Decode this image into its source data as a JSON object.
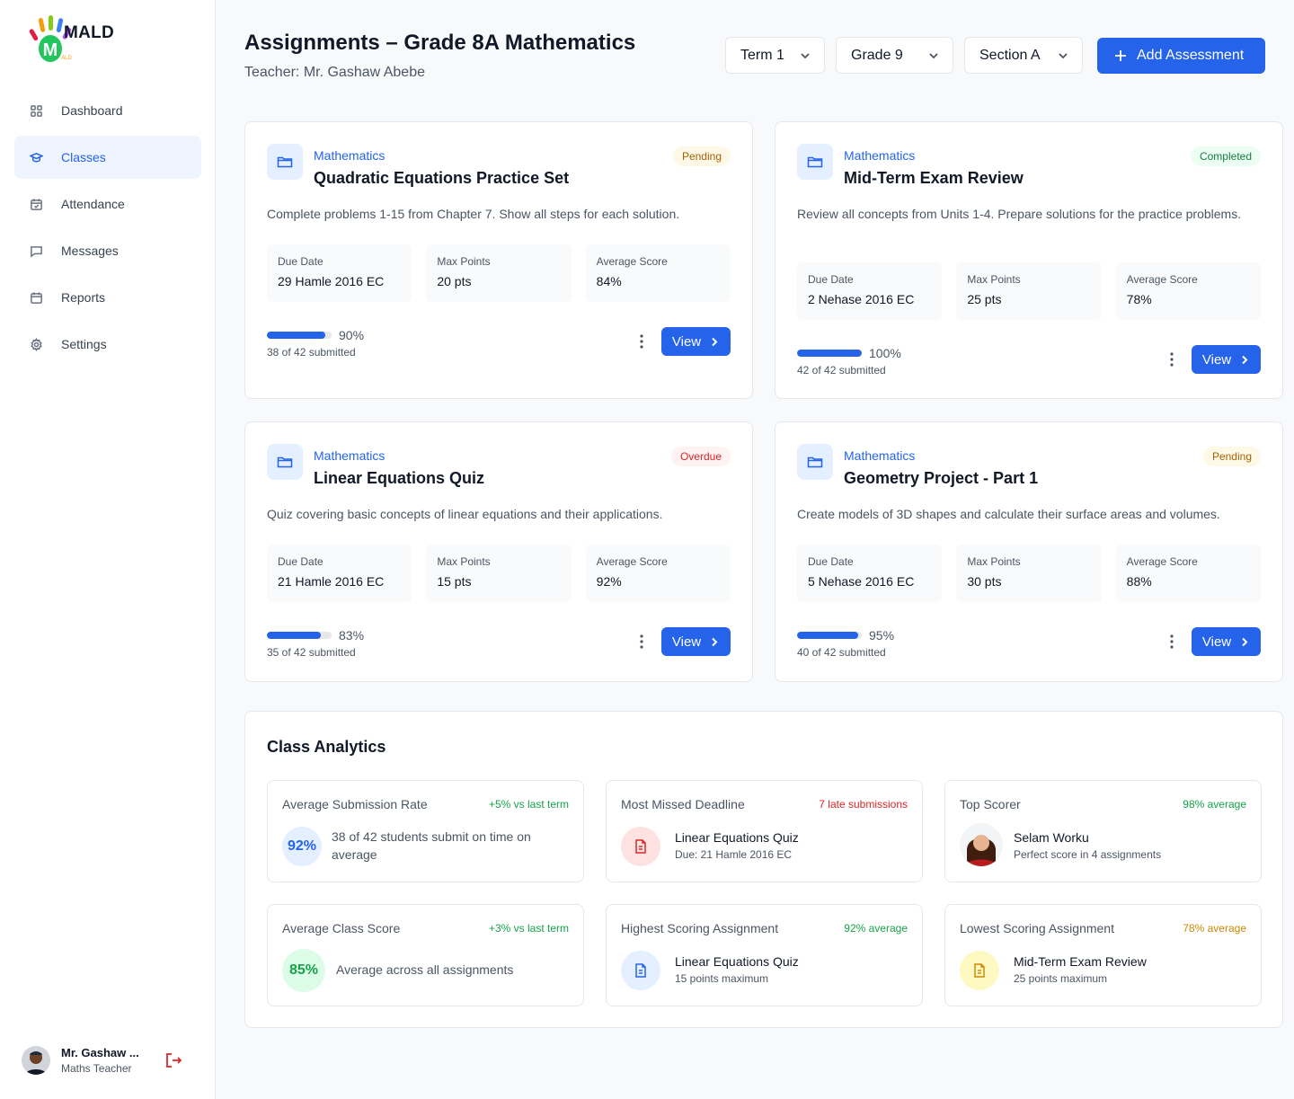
{
  "app": {
    "name": "MALD"
  },
  "sidebar": {
    "items": [
      {
        "label": "Dashboard",
        "icon": "grid-icon"
      },
      {
        "label": "Classes",
        "icon": "graduation-cap-icon",
        "active": true
      },
      {
        "label": "Attendance",
        "icon": "calendar-check-icon"
      },
      {
        "label": "Messages",
        "icon": "message-icon"
      },
      {
        "label": "Reports",
        "icon": "calendar-icon"
      },
      {
        "label": "Settings",
        "icon": "gear-icon"
      }
    ],
    "user": {
      "name": "Mr. Gashaw ...",
      "role": "Maths Teacher"
    }
  },
  "header": {
    "title": "Assignments – Grade 8A Mathematics",
    "subtitle": "Teacher: Mr. Gashaw Abebe",
    "term": "Term 1",
    "grade": "Grade 9",
    "section": "Section A",
    "add_button": "Add Assessment"
  },
  "labels": {
    "due_date": "Due Date",
    "max_points": "Max Points",
    "average_score": "Average Score",
    "view": "View"
  },
  "assignments": [
    {
      "subject": "Mathematics",
      "title": "Quadratic Equations Practice Set",
      "status": "Pending",
      "description": "Complete problems 1-15 from Chapter 7. Show all steps for each solution.",
      "due": "29 Hamle 2016 EC",
      "points": "20 pts",
      "avg": "84%",
      "progress": 90,
      "progress_label": "90%",
      "submitted": "38 of 42 submitted"
    },
    {
      "subject": "Mathematics",
      "title": "Mid-Term Exam Review",
      "status": "Completed",
      "description": "Review all concepts from Units 1-4. Prepare solutions for the practice problems.",
      "due": "2 Nehase 2016 EC",
      "points": "25 pts",
      "avg": "78%",
      "progress": 100,
      "progress_label": "100%",
      "submitted": "42 of 42 submitted"
    },
    {
      "subject": "Mathematics",
      "title": "Linear Equations Quiz",
      "status": "Overdue",
      "description": "Quiz covering basic concepts of linear equations and their applications.",
      "due": "21 Hamle 2016 EC",
      "points": "15 pts",
      "avg": "92%",
      "progress": 83,
      "progress_label": "83%",
      "submitted": "35 of 42 submitted"
    },
    {
      "subject": "Mathematics",
      "title": "Geometry Project - Part 1",
      "status": "Pending",
      "description": "Create models of 3D shapes and calculate their surface areas and volumes.",
      "due": "5 Nehase 2016 EC",
      "points": "30 pts",
      "avg": "88%",
      "progress": 95,
      "progress_label": "95%",
      "submitted": "40 of 42 submitted"
    }
  ],
  "analytics": {
    "title": "Class Analytics",
    "submission_rate": {
      "label": "Average Submission Rate",
      "note": "+5% vs last term",
      "value": "92%",
      "text": "38 of 42 students submit on time on average"
    },
    "missed_deadline": {
      "label": "Most Missed Deadline",
      "note": "7 late submissions",
      "main": "Linear Equations Quiz",
      "sub": "Due: 21 Hamle 2016 EC",
      "icon": "document-icon"
    },
    "top_scorer": {
      "label": "Top Scorer",
      "note": "98% average",
      "main": "Selam Worku",
      "sub": "Perfect score in 4 assignments"
    },
    "class_score": {
      "label": "Average Class Score",
      "note": "+3% vs last term",
      "value": "85%",
      "text": "Average across all assignments"
    },
    "highest": {
      "label": "Highest Scoring Assignment",
      "note": "92% average",
      "main": "Linear Equations Quiz",
      "sub": "15 points maximum",
      "icon": "document-icon"
    },
    "lowest": {
      "label": "Lowest Scoring Assignment",
      "note": "78% average",
      "main": "Mid-Term Exam Review",
      "sub": "25 points maximum",
      "icon": "document-icon"
    }
  },
  "colors": {
    "primary": "#2563eb",
    "pending": "#a16207",
    "completed": "#15803d",
    "overdue": "#dc2626"
  }
}
